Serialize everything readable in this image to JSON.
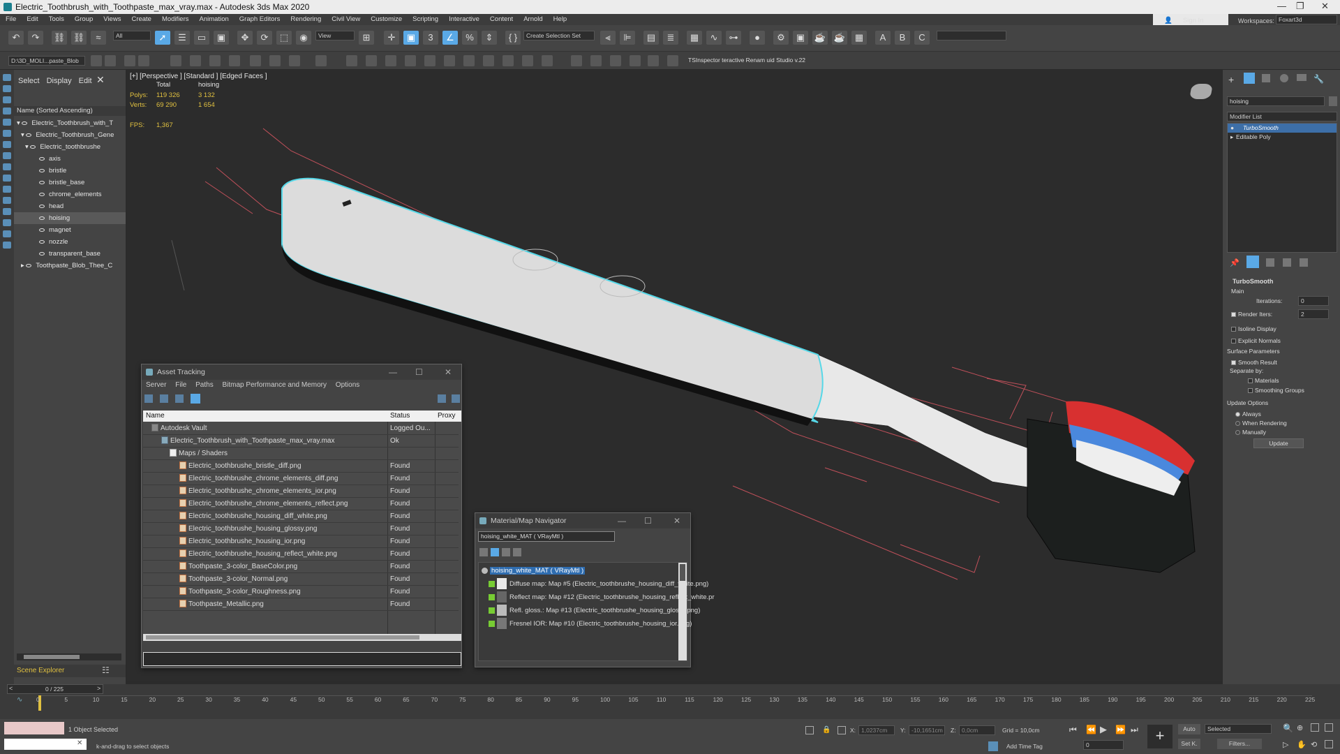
{
  "title": "Electric_Toothbrush_with_Toothpaste_max_vray.max - Autodesk 3ds Max 2020",
  "menu": [
    "File",
    "Edit",
    "Tools",
    "Group",
    "Views",
    "Create",
    "Modifiers",
    "Animation",
    "Graph Editors",
    "Rendering",
    "Civil View",
    "Customize",
    "Scripting",
    "Interactive",
    "Content",
    "Arnold",
    "Help"
  ],
  "account": {
    "sign_in": "Sign In",
    "workspaces_label": "Workspaces:",
    "workspace_value": "Foxart3d"
  },
  "toolbar": {
    "filter": "All",
    "view": "View",
    "selection_set": "Create Selection Set",
    "path": "D:\\3D_MOLI...paste_Blob",
    "plugins": "TSInspector   teractive Renam   uid Studio v.22"
  },
  "scene_explorer": {
    "tabs": [
      "Select",
      "Display",
      "Edit"
    ],
    "header": "Name (Sorted Ascending)",
    "items": [
      {
        "label": "Electric_Toothbrush_with_T"
      },
      {
        "label": "Electric_Toothbrush_Gene"
      },
      {
        "label": "Electric_toothbrushe"
      },
      {
        "label": "axis"
      },
      {
        "label": "bristle"
      },
      {
        "label": "bristle_base"
      },
      {
        "label": "chrome_elements"
      },
      {
        "label": "head"
      },
      {
        "label": "hoising"
      },
      {
        "label": "magnet"
      },
      {
        "label": "nozzle"
      },
      {
        "label": "transparent_base"
      },
      {
        "label": "Toothpaste_Blob_Thee_C"
      }
    ],
    "footer": "Scene Explorer"
  },
  "viewport": {
    "label": "[+] [Perspective ] [Standard ] [Edged Faces ]",
    "col_total": "Total",
    "col_sel": "hoising",
    "polys_label": "Polys:",
    "polys_total": "119 326",
    "polys_sel": "3 132",
    "verts_label": "Verts:",
    "verts_total": "69 290",
    "verts_sel": "1 654",
    "fps_label": "FPS:",
    "fps": "1,367"
  },
  "asset_tracking": {
    "title": "Asset Tracking",
    "menu": [
      "Server",
      "File",
      "Paths",
      "Bitmap Performance and Memory",
      "Options"
    ],
    "cols": [
      "Name",
      "Status",
      "Proxy"
    ],
    "rows": [
      {
        "name": "Autodesk Vault",
        "status": "Logged Ou..."
      },
      {
        "name": "Electric_Toothbrush_with_Toothpaste_max_vray.max",
        "status": "Ok"
      },
      {
        "name": "Maps / Shaders",
        "status": ""
      },
      {
        "name": "Electric_toothbrushe_bristle_diff.png",
        "status": "Found"
      },
      {
        "name": "Electric_toothbrushe_chrome_elements_diff.png",
        "status": "Found"
      },
      {
        "name": "Electric_toothbrushe_chrome_elements_ior.png",
        "status": "Found"
      },
      {
        "name": "Electric_toothbrushe_chrome_elements_reflect.png",
        "status": "Found"
      },
      {
        "name": "Electric_toothbrushe_housing_diff_white.png",
        "status": "Found"
      },
      {
        "name": "Electric_toothbrushe_housing_glossy.png",
        "status": "Found"
      },
      {
        "name": "Electric_toothbrushe_housing_ior.png",
        "status": "Found"
      },
      {
        "name": "Electric_toothbrushe_housing_reflect_white.png",
        "status": "Found"
      },
      {
        "name": "Toothpaste_3-color_BaseColor.png",
        "status": "Found"
      },
      {
        "name": "Toothpaste_3-color_Normal.png",
        "status": "Found"
      },
      {
        "name": "Toothpaste_3-color_Roughness.png",
        "status": "Found"
      },
      {
        "name": "Toothpaste_Metallic.png",
        "status": "Found"
      }
    ]
  },
  "material_nav": {
    "title": "Material/Map Navigator",
    "field": "hoising_white_MAT  ( VRayMtl )",
    "root": "hoising_white_MAT  ( VRayMtl )",
    "items": [
      "Diffuse map: Map #5 (Electric_toothbrushe_housing_diff_white.png)",
      "Reflect map: Map #12 (Electric_toothbrushe_housing_reflect_white.pr",
      "Refl. gloss.: Map #13 (Electric_toothbrushe_housing_glossy.png)",
      "Fresnel IOR: Map #10 (Electric_toothbrushe_housing_ior.png)"
    ]
  },
  "command_panel": {
    "name_field": "hoising",
    "modifier_list": "Modifier List",
    "stack": [
      "TurboSmooth",
      "Editable Poly"
    ],
    "rollout": "TurboSmooth",
    "main": "Main",
    "iterations_label": "Iterations:",
    "iterations": "0",
    "render_iters_label": "Render Iters:",
    "render_iters": "2",
    "isoline": "Isoline Display",
    "explicit": "Explicit Normals",
    "surface": "Surface Parameters",
    "smooth_result": "Smooth Result",
    "separate": "Separate by:",
    "materials": "Materials",
    "smoothing_groups": "Smoothing Groups",
    "update_options": "Update Options",
    "always": "Always",
    "when_rendering": "When Rendering",
    "manually": "Manually",
    "update_btn": "Update"
  },
  "timeline": {
    "frame": "0 / 225",
    "ticks": [
      "0",
      "5",
      "10",
      "15",
      "20",
      "25",
      "30",
      "35",
      "40",
      "45",
      "50",
      "55",
      "60",
      "65",
      "70",
      "75",
      "80",
      "85",
      "90",
      "95",
      "100",
      "105",
      "110",
      "115",
      "120",
      "125",
      "130",
      "135",
      "140",
      "145",
      "150",
      "155",
      "160",
      "165",
      "170",
      "175",
      "180",
      "185",
      "190",
      "195",
      "200",
      "205",
      "210",
      "215",
      "220",
      "225"
    ]
  },
  "status": {
    "selected": "1 Object Selected",
    "prompt": "k-and-drag to select objects",
    "x_label": "X:",
    "x": "1,0237cm",
    "y_label": "Y:",
    "y": "-10,1651cm",
    "z_label": "Z:",
    "z": "0,0cm",
    "grid": "Grid = 10,0cm",
    "add_time_tag": "Add Time Tag",
    "auto": "Auto",
    "selected_drop": "Selected",
    "setk": "Set K.",
    "filters": "Filters...",
    "frame_field": "0"
  },
  "colors": {
    "accent": "#5aa9e6",
    "selection": "#56d8e8",
    "stat_yellow": "#e0c040"
  }
}
